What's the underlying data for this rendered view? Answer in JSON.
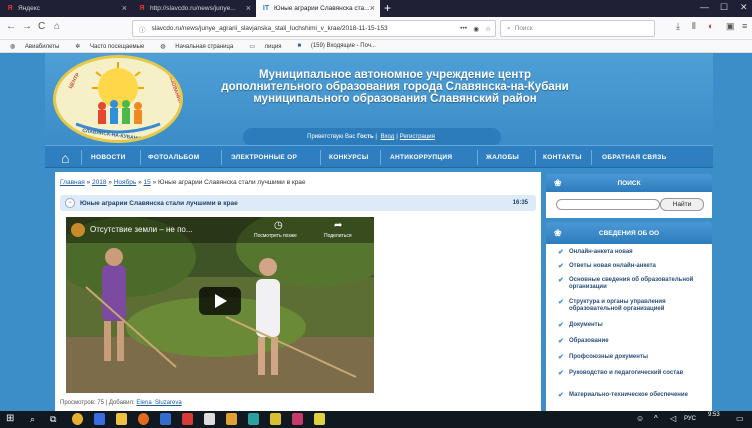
{
  "browser": {
    "tabs": [
      {
        "title": "Яндекс"
      },
      {
        "title": "http://slavcdo.ru/news/junye..."
      },
      {
        "title": "Юные аграрии Славянска ста..."
      }
    ],
    "url": "slavcdo.ru/news/junye_agrarii_slavjanska_stali_luchshimi_v_krae/2018-11-15-153",
    "search_placeholder": "Поиск",
    "bookmarks": [
      "Авиабилеты",
      "Часто посещаемые",
      "Начальная страница",
      "лиция",
      "(159) Входящие - Поч..."
    ]
  },
  "header": {
    "title_line1": "Муниципальное автономное учреждение центр",
    "title_line2": "дополнительного образования города Славянска-на-Кубани",
    "title_line3": "муниципального образования Славянский район",
    "greeting_prefix": "Приветствую Вас",
    "greeting_user": "Гость",
    "login": "Вход",
    "register": "Регистрация",
    "logo_text_top": "ЦЕНТР",
    "logo_text_bottom": "СЛАВЯНСК-НА-КУБАНИ",
    "logo_text_right": "ОБРАЗОВАНИЯ"
  },
  "menu": [
    "НОВОСТИ",
    "ФОТОАЛЬБОМ",
    "ЭЛЕКТРОННЫЕ ОР",
    "КОНКУРСЫ",
    "АНТИКОРРУПЦИЯ",
    "ЖАЛОБЫ",
    "КОНТАКТЫ",
    "ОБРАТНАЯ СВЯЗЬ"
  ],
  "breadcrumb": {
    "home": "Главная",
    "year": "2018",
    "month": "Ноябрь",
    "day": "15",
    "current": "Юные аграрии Славянска стали лучшими в крае",
    "sep": "»"
  },
  "article": {
    "title": "Юные аграрии Славянска стали лучшими в крае",
    "time": "16:35",
    "video_title": "Отсутствие земли – не по...",
    "watch_later": "Посмотреть позже",
    "share": "Поделиться",
    "views_label": "Просмотров: 75",
    "added_label": "Добавил:",
    "author": "Elena_Sluzareva"
  },
  "sidebar": {
    "search_title": "ПОИСК",
    "search_button": "Найти",
    "info_title": "СВЕДЕНИЯ ОБ ОО",
    "items": [
      "Онлайн-анкета новая",
      "Ответы новая онлайн-анкета",
      "Основные сведения об образовательной организации",
      "Структура и органы управления образовательной организацией",
      "Документы",
      "Образование",
      "Профсоюзные документы",
      "Руководство и педагогический состав",
      "Материально-техническое обеспечение"
    ]
  },
  "taskbar": {
    "lang": "РУС",
    "time": "9:53"
  }
}
